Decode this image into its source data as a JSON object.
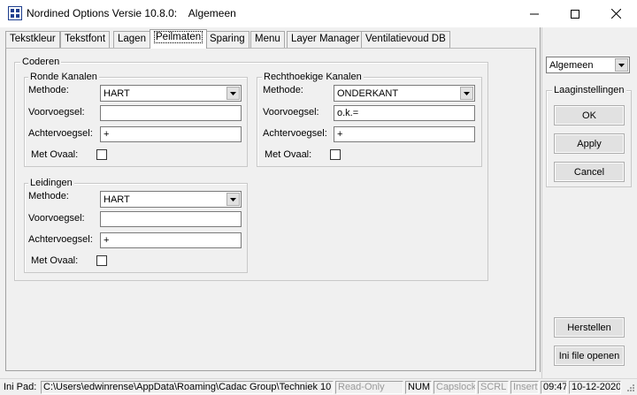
{
  "window": {
    "title": "Nordined Options Versie 10.8.0:    Algemeen",
    "minimize_glyph": "─",
    "maximize_glyph": "☐",
    "close_glyph": "✕"
  },
  "tabs": [
    {
      "label": "Tekstkleur"
    },
    {
      "label": "Tekstfont"
    },
    {
      "label": "Lagen"
    },
    {
      "label": "Peilmaten"
    },
    {
      "label": "Sparing"
    },
    {
      "label": "Menu"
    },
    {
      "label": "Layer Manager"
    },
    {
      "label": "Ventilatievoud DB"
    }
  ],
  "coderen": {
    "label": "Coderen",
    "ronde": {
      "label": "Ronde Kanalen",
      "methode_label": "Methode:",
      "methode_value": "HART",
      "voorvoegsel_label": "Voorvoegsel:",
      "voorvoegsel_value": "",
      "achtervoegsel_label": "Achtervoegsel:",
      "achtervoegsel_value": "+",
      "ovaal_label": "Met Ovaal:"
    },
    "rechthoekig": {
      "label": "Rechthoekige Kanalen",
      "methode_label": "Methode:",
      "methode_value": "ONDERKANT",
      "voorvoegsel_label": "Voorvoegsel:",
      "voorvoegsel_value": "o.k.=",
      "achtervoegsel_label": "Achtervoegsel:",
      "achtervoegsel_value": "+",
      "ovaal_label": "Met Ovaal:"
    },
    "leidingen": {
      "label": "Leidingen",
      "methode_label": "Methode:",
      "methode_value": "HART",
      "voorvoegsel_label": "Voorvoegsel:",
      "voorvoegsel_value": "",
      "achtervoegsel_label": "Achtervoegsel:",
      "achtervoegsel_value": "+",
      "ovaal_label": "Met Ovaal:"
    }
  },
  "side": {
    "profile_select": "Algemeen",
    "group_label": "Laaginstellingen",
    "ok": "OK",
    "apply": "Apply",
    "cancel": "Cancel",
    "herstellen": "Herstellen",
    "ini_open": "Ini file openen"
  },
  "status": {
    "ini_label": "Ini Pad:",
    "ini_path": "C:\\Users\\edwinrense\\AppData\\Roaming\\Cadac Group\\Techniek 10",
    "readonly": "Read-Only",
    "num": "NUM",
    "capslock": "Capslock",
    "scrl": "SCRL",
    "insert": "Insert",
    "time": "09:47",
    "date": "10-12-2020"
  }
}
